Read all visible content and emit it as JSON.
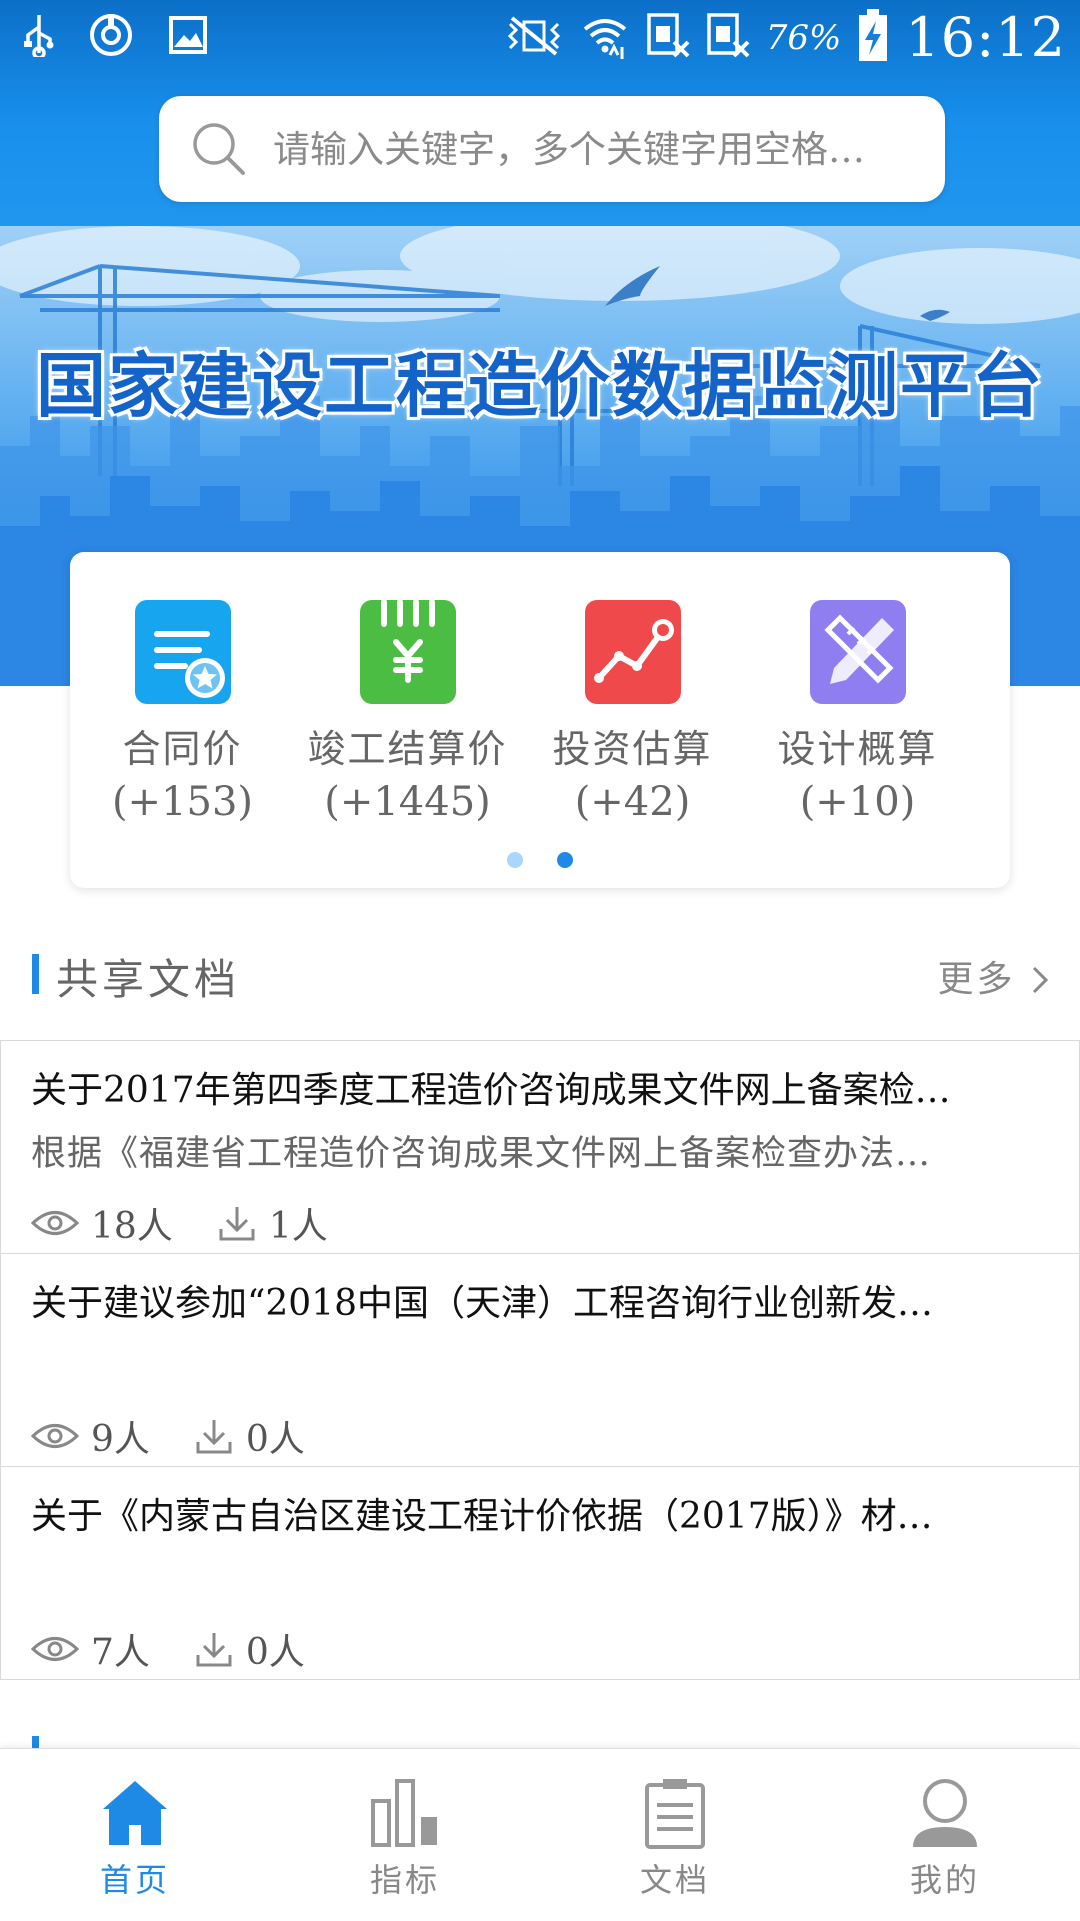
{
  "status_bar": {
    "battery": "76%",
    "time": "16:12"
  },
  "search": {
    "placeholder": "请输入关键字，多个关键字用空格…"
  },
  "banner": {
    "title": "国家建设工程造价数据监测平台"
  },
  "categories": [
    {
      "label": "合同价",
      "count": "(+153)",
      "icon": "contract-icon",
      "color": "#18a5ef"
    },
    {
      "label": "竣工结算价",
      "count": "(+1445)",
      "icon": "yen-notebook-icon",
      "color": "#4cbd43"
    },
    {
      "label": "投资估算",
      "count": "(+42)",
      "icon": "line-chart-icon",
      "color": "#f0494b"
    },
    {
      "label": "设计概算",
      "count": "(+10)",
      "icon": "pencil-ruler-icon",
      "color": "#8f7ef0"
    }
  ],
  "carousel": {
    "pages": 2,
    "active_page": 2
  },
  "shared_docs": {
    "title": "共享文档",
    "more": "更多",
    "items": [
      {
        "title": "关于2017年第四季度工程造价咨询成果文件网上备案检…",
        "summary": "根据《福建省工程造价咨询成果文件网上备案检查办法…",
        "views": "18人",
        "downloads": "1人"
      },
      {
        "title": "关于建议参加“2018中国（天津）工程咨询行业创新发…",
        "summary": "",
        "views": "9人",
        "downloads": "0人"
      },
      {
        "title": "关于《内蒙古自治区建设工程计价依据（2017版）》材…",
        "summary": "",
        "views": "7人",
        "downloads": "0人"
      }
    ]
  },
  "bottom_nav": [
    {
      "label": "首页",
      "icon": "home-icon",
      "active": true
    },
    {
      "label": "指标",
      "icon": "bar-chart-icon",
      "active": false
    },
    {
      "label": "文档",
      "icon": "document-icon",
      "active": false
    },
    {
      "label": "我的",
      "icon": "user-icon",
      "active": false
    }
  ],
  "colors": {
    "primary": "#1f8ae6",
    "header_top": "#0c6fc8",
    "text_gray": "#666666"
  }
}
